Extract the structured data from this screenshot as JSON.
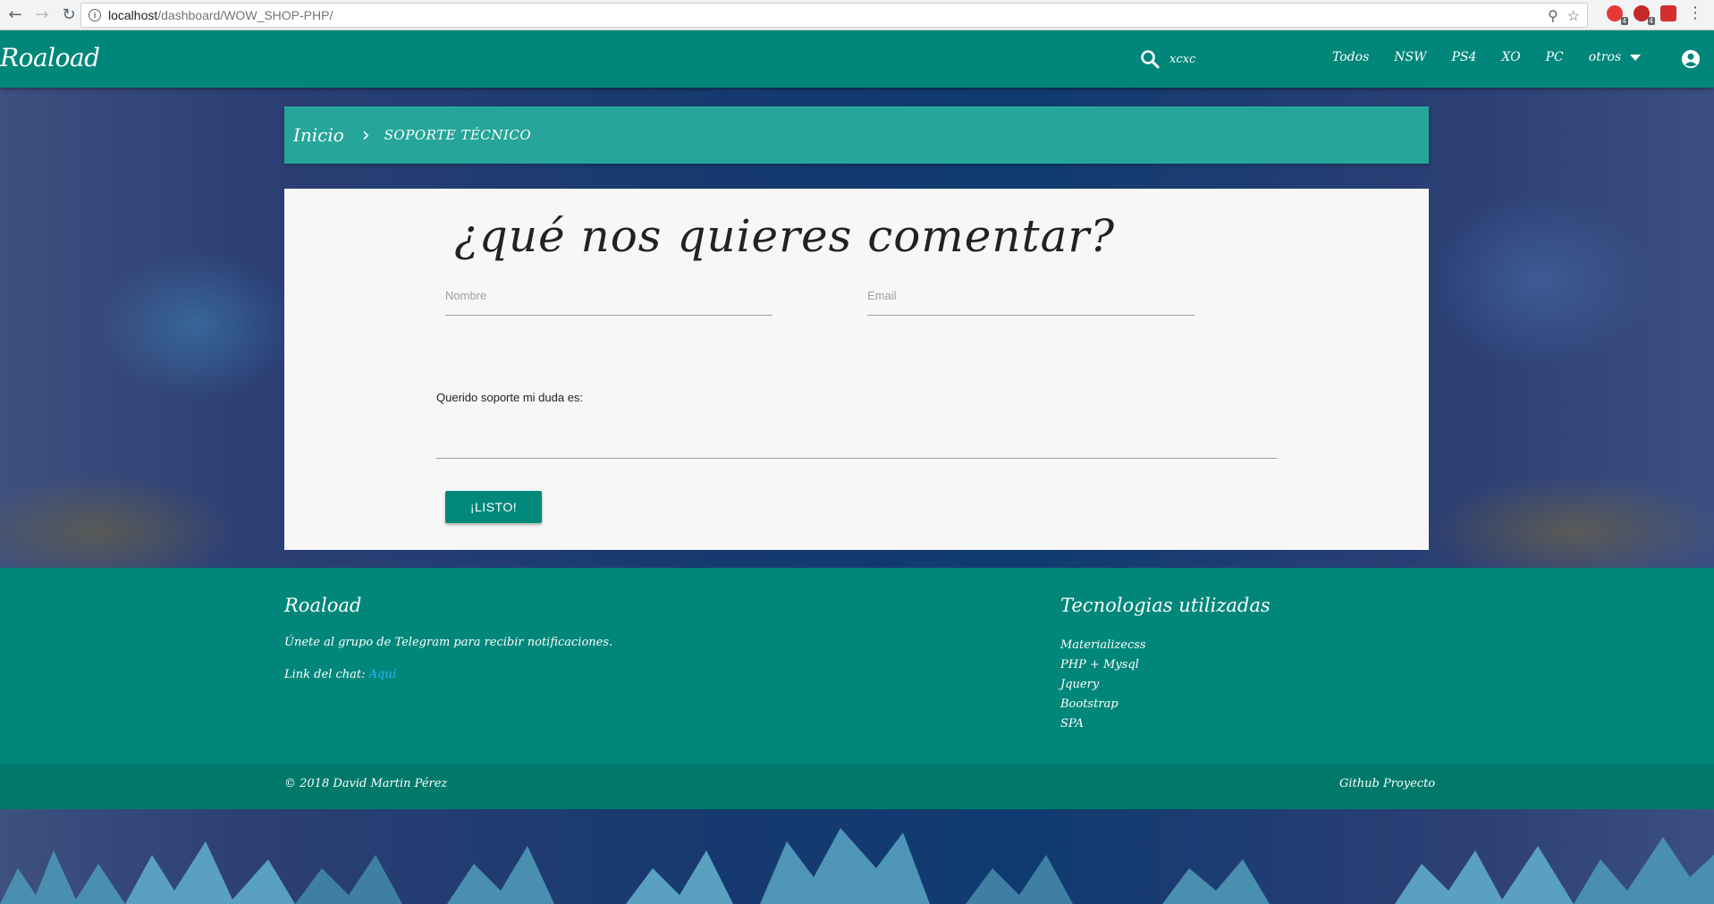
{
  "browser": {
    "url_host": "localhost",
    "url_path": "/dashboard/WOW_SHOP-PHP/",
    "extension_badges": [
      "4",
      "4"
    ]
  },
  "nav": {
    "brand": "Roaload",
    "search_value": "xcxc",
    "links": [
      "Todos",
      "NSW",
      "PS4",
      "XO",
      "PC",
      "otros"
    ]
  },
  "breadcrumb": {
    "home": "Inicio",
    "current": "SOPORTE TÉCNICO"
  },
  "form": {
    "title": "¿qué nos quieres comentar?",
    "name_placeholder": "Nombre",
    "email_placeholder": "Email",
    "textarea_label": "Querido soporte mi duda es:",
    "submit_label": "¡LISTO!"
  },
  "footer": {
    "brand": "Roaload",
    "telegram_text": "Únete al grupo de Telegram para recibir notificaciones.",
    "chat_label": "Link del chat:",
    "chat_link": "Aquí",
    "tech_title": "Tecnologias utilizadas",
    "tech_list": [
      "Materializecss",
      "PHP + Mysql",
      "Jquery",
      "Bootstrap",
      "SPA"
    ],
    "copyright": "© 2018 David Martin Pérez",
    "github": "Github Proyecto"
  },
  "colors": {
    "primary": "#00877a",
    "breadcrumb": "#26a69a",
    "button": "#00897b",
    "link": "#29b6f6"
  }
}
